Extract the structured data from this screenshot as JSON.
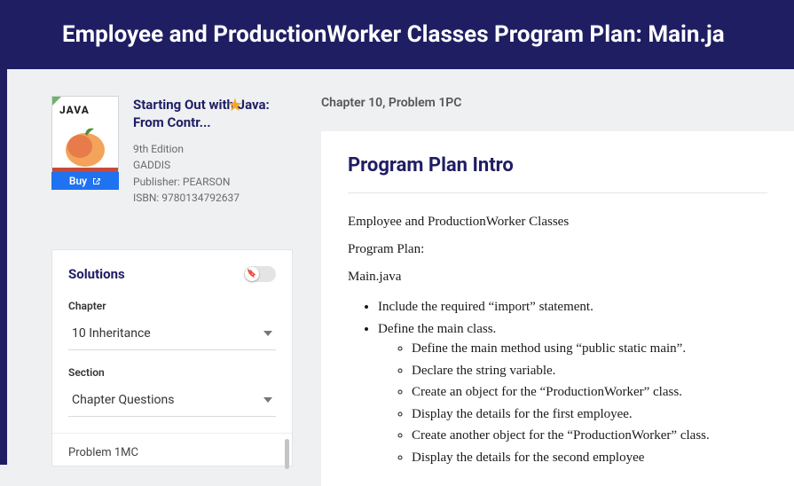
{
  "header": {
    "title": "Employee and ProductionWorker Classes Program Plan: Main.ja"
  },
  "book": {
    "cover_word": "JAVA",
    "title": "Starting Out with Java: From Contr...",
    "edition": "9th Edition",
    "author": "GADDIS",
    "publisher": "Publisher: PEARSON",
    "isbn": "ISBN: 9780134792637",
    "buy_label": "Buy"
  },
  "solutions": {
    "title": "Solutions",
    "chapter_label": "Chapter",
    "chapter_value": "10 Inheritance",
    "section_label": "Section",
    "section_value": "Chapter Questions",
    "problem": "Problem 1MC"
  },
  "main": {
    "crumb": "Chapter 10, Problem 1PC",
    "heading": "Program Plan Intro",
    "p1": "Employee and ProductionWorker Classes",
    "p2": "Program Plan:",
    "p3": "Main.java",
    "bullets": [
      "Include the required “import” statement.",
      "Define the main class."
    ],
    "sub_bullets": [
      "Define the main method using “public static main”.",
      "Declare the string variable.",
      "Create an object for the “ProductionWorker” class.",
      "Display the details for the first employee.",
      "Create another object for the “ProductionWorker” class.",
      "Display the details for the second employee"
    ]
  }
}
